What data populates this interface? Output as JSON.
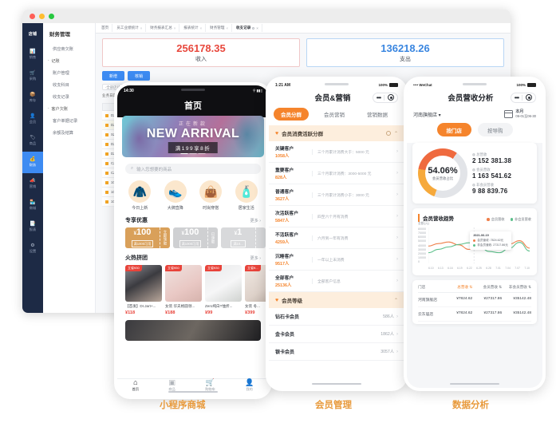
{
  "heading": "财务管理",
  "desktop": {
    "rail": {
      "logo": "店铺",
      "items": [
        {
          "icon": "📊",
          "label": "销售"
        },
        {
          "icon": "🛒",
          "label": "采购"
        },
        {
          "icon": "📦",
          "label": "库存"
        },
        {
          "icon": "👤",
          "label": "会员"
        },
        {
          "icon": "🏷",
          "label": "商品"
        },
        {
          "icon": "💰",
          "label": "财务",
          "active": true
        },
        {
          "icon": "📣",
          "label": "营销"
        },
        {
          "icon": "🏪",
          "label": "商城"
        },
        {
          "icon": "📑",
          "label": "报表"
        },
        {
          "icon": "⚙",
          "label": "设置"
        }
      ]
    },
    "submenu": {
      "title": "财务管理",
      "items": [
        {
          "type": "item",
          "label": "供应商欠账"
        },
        {
          "type": "group",
          "label": "记账"
        },
        {
          "type": "item",
          "label": "账户管理"
        },
        {
          "type": "item",
          "label": "收支科目"
        },
        {
          "type": "item",
          "label": "收支记录"
        },
        {
          "type": "group",
          "label": "客户欠账"
        },
        {
          "type": "item",
          "label": "客户单据记录"
        },
        {
          "type": "item",
          "label": "余额及结算"
        }
      ]
    },
    "tabs": [
      {
        "label": "首页",
        "closable": false
      },
      {
        "label": "员工业绩统计",
        "closable": true
      },
      {
        "label": "财务报表汇总",
        "closable": true
      },
      {
        "label": "报表统计",
        "closable": true
      },
      {
        "label": "财务管理",
        "closable": true
      },
      {
        "label": "收支记录",
        "closable": true,
        "active": true
      }
    ],
    "stats": [
      {
        "value": "256178.35",
        "label": "收入",
        "color": "#e8483d"
      },
      {
        "value": "136218.26",
        "label": "支出",
        "color": "#3a86e0"
      }
    ],
    "buttons": [
      {
        "label": "新增"
      },
      {
        "label": "核销"
      }
    ],
    "filters": [
      {
        "label": "",
        "value": "-全部店铺-"
      },
      {
        "label": "业务日期",
        "value": ""
      }
    ],
    "table": {
      "header": "流水号",
      "rows": [
        {
          "id": "DZ20230000..."
        },
        {
          "id": "DZ20230000082..."
        },
        {
          "id": "SZ20190000..."
        },
        {
          "id": "DZ20190000..."
        },
        {
          "id": "DZ20190000..."
        },
        {
          "id": "CZZ2018009..."
        },
        {
          "id": "CZZ2018009..."
        },
        {
          "id": "1001009000 3..."
        },
        {
          "id": "1001009000 2..."
        },
        {
          "id": "1001009000 1..."
        }
      ]
    }
  },
  "phone1": {
    "caption": "小程序商城",
    "status": {
      "time": "14:30",
      "carrier": "",
      "battery": "100%"
    },
    "title": "首页",
    "banner": {
      "sub": "正在新款",
      "main": "NEW ARRIVAL",
      "tag": "满199享8折"
    },
    "search_placeholder": "输入您想要的商品",
    "categories": [
      {
        "icon": "🧥",
        "label": "今日上新"
      },
      {
        "icon": "👟",
        "label": "大牌直降"
      },
      {
        "icon": "👜",
        "label": "时尚穿搭"
      },
      {
        "icon": "🧴",
        "label": "居家生活"
      }
    ],
    "coupon_section": {
      "title": "专享优惠",
      "more": "更多"
    },
    "coupons": [
      {
        "amount": "100",
        "cond": "满1000可用",
        "side": "立即领取",
        "state": "active"
      },
      {
        "amount": "100",
        "cond": "满1000可用",
        "side": "已领取",
        "state": "used"
      },
      {
        "amount": "1",
        "cond": "满10...",
        "side": "",
        "state": "used"
      }
    ],
    "group_section": {
      "title": "火热拼团",
      "more": "更多"
    },
    "products": [
      {
        "badge": "立省¥30",
        "name": "【首发】Dr.Jart+...",
        "price": "¥118"
      },
      {
        "badge": "立省¥50",
        "name": "女装 华夫格圆领...",
        "price": "¥188"
      },
      {
        "badge": "立省¥30",
        "name": "Zero纯白T恤折...",
        "price": "¥99"
      },
      {
        "badge": "立省¥...",
        "name": "女装 冬...",
        "price": "¥399"
      }
    ],
    "tabbar": [
      {
        "icon": "⌂",
        "label": "首页",
        "active": true
      },
      {
        "icon": "▣",
        "label": "商品",
        "active": false
      },
      {
        "icon": "🛒",
        "label": "购物车",
        "active": false
      },
      {
        "icon": "👤",
        "label": "我的",
        "active": false
      }
    ]
  },
  "phone2": {
    "caption": "会员管理",
    "status": {
      "time": "1:21 AM",
      "battery": "100%"
    },
    "title": "会员&营销",
    "segments": [
      {
        "label": "会员分群",
        "active": true
      },
      {
        "label": "会员营销",
        "active": false
      },
      {
        "label": "营销数据",
        "active": false
      }
    ],
    "group1": {
      "title": "会员消费活跃分群",
      "rows": [
        {
          "name": "关键客户",
          "count": "1058人",
          "desc": "三个月累计消费大于：5000 元"
        },
        {
          "name": "重要客户",
          "count": "828人",
          "desc": "三个月累计消费：3000-5000 元"
        },
        {
          "name": "普通客户",
          "count": "3627人",
          "desc": "三个月累计消费小于：3000 元"
        },
        {
          "name": "次活跃客户",
          "count": "5847人",
          "desc": "四至六个月有消费"
        },
        {
          "name": "不活跃客户",
          "count": "4259人",
          "desc": "六月到一年有消费"
        },
        {
          "name": "沉睡客户",
          "count": "9517人",
          "desc": "一年以上未消费"
        },
        {
          "name": "全部客户",
          "count": "25136人",
          "desc": "全部客户信息"
        }
      ]
    },
    "group2": {
      "title": "会员等级",
      "rows": [
        {
          "name": "钻石卡会员",
          "count": "586人"
        },
        {
          "name": "金卡会员",
          "count": "1862人"
        },
        {
          "name": "银卡会员",
          "count": "3057人"
        }
      ]
    }
  },
  "phone3": {
    "caption": "数据分析",
    "status": {
      "time": "",
      "carrier": "WeChat",
      "battery": "100%"
    },
    "title": "会员营收分析",
    "store_filter": "河南旗舰店",
    "date_filter": {
      "label": "本月",
      "range": "06-01至06-30"
    },
    "segments": [
      {
        "label": "按门店",
        "active": true
      },
      {
        "label": "按导购",
        "active": false
      }
    ],
    "donut": {
      "pct": "54.06%",
      "label": "会员营收占比"
    },
    "kpis": [
      {
        "label": "总营收",
        "value": "2 152 381.38"
      },
      {
        "label": "会员营收",
        "value": "1 163 541.62"
      },
      {
        "label": "非会员营收",
        "value": "9 88 839.76"
      }
    ],
    "chart_title": "会员营收趋势",
    "table": {
      "headers": [
        "门店",
        "总营收",
        "会员营收",
        "非会员营收"
      ],
      "rows": [
        [
          "河南旗舰店",
          "¥7824.62",
          "¥27317.86",
          "¥35142.48"
        ],
        [
          "云东居店",
          "¥7824.62",
          "¥27317.86",
          "¥35142.48"
        ]
      ]
    }
  },
  "chart_data": {
    "type": "line",
    "title": "会员营收趋势",
    "ylabel": "金额(元)",
    "xlabel": "",
    "grid": false,
    "legend_position": "top-right",
    "x": [
      "6.10",
      "6.13",
      "6.16",
      "6.19",
      "6.22",
      "6.25",
      "6.28",
      "7.01",
      "7.04",
      "7.07",
      "7.10"
    ],
    "ytick_labels": [
      "80000",
      "70000",
      "60000",
      "50000",
      "40000",
      "30000",
      "20000",
      "10000",
      "0"
    ],
    "ylim": [
      0,
      80000
    ],
    "series": [
      {
        "name": "会员营收",
        "color": "#ef7f4a",
        "values": [
          38000,
          44000,
          48000,
          41000,
          30000,
          35000,
          45000,
          44000,
          43000,
          51000,
          33000
        ]
      },
      {
        "name": "非会员营收",
        "color": "#5bbf8a",
        "values": [
          22000,
          30000,
          36000,
          42000,
          46000,
          38000,
          25000,
          22000,
          33000,
          47000,
          26000
        ]
      }
    ],
    "annotation": {
      "date": "2021-06-19",
      "rows": [
        {
          "label": "会员营收",
          "value": "7824.62元",
          "color": "#ef7f4a"
        },
        {
          "label": "非会员营收",
          "value": "27317.86元",
          "color": "#5bbf8a"
        }
      ]
    }
  }
}
